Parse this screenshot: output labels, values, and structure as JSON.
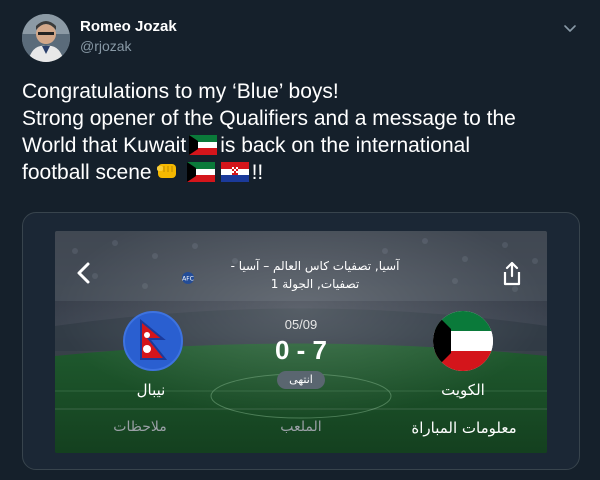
{
  "author": {
    "name": "Romeo Jozak",
    "handle": "@rjozak"
  },
  "tweet": {
    "line1": "Congratulations to my ‘Blue’ boys!",
    "line2": "Strong opener of the Qualifiers and a message to the",
    "line3a": "World that Kuwait",
    "line3b": "is back on the international",
    "line4a": "football scene",
    "line4b": "!!"
  },
  "match": {
    "header_line1": "آسيا, تصفيات كاس العالم – آسيا -",
    "header_line2": "تصفيات, الجولة 1",
    "date": "05/09",
    "score": "0 - 7",
    "status": "انتهى",
    "home_team": "نيبال",
    "away_team": "الكويت",
    "tabs": [
      "ملاحظات",
      "الملعب",
      "معلومات المباراة"
    ]
  },
  "colors": {
    "background": "#15202b",
    "muted": "#8899a6",
    "nepal_circle": "#2a5fd0",
    "kuwait_green": "#0a7a3a",
    "kuwait_red": "#d4151b"
  },
  "icons": [
    "chevron-down-icon",
    "back-arrow-icon",
    "share-icon",
    "afc-logo-icon",
    "fist-emoji-icon",
    "kuwait-flag-icon",
    "croatia-flag-icon"
  ]
}
